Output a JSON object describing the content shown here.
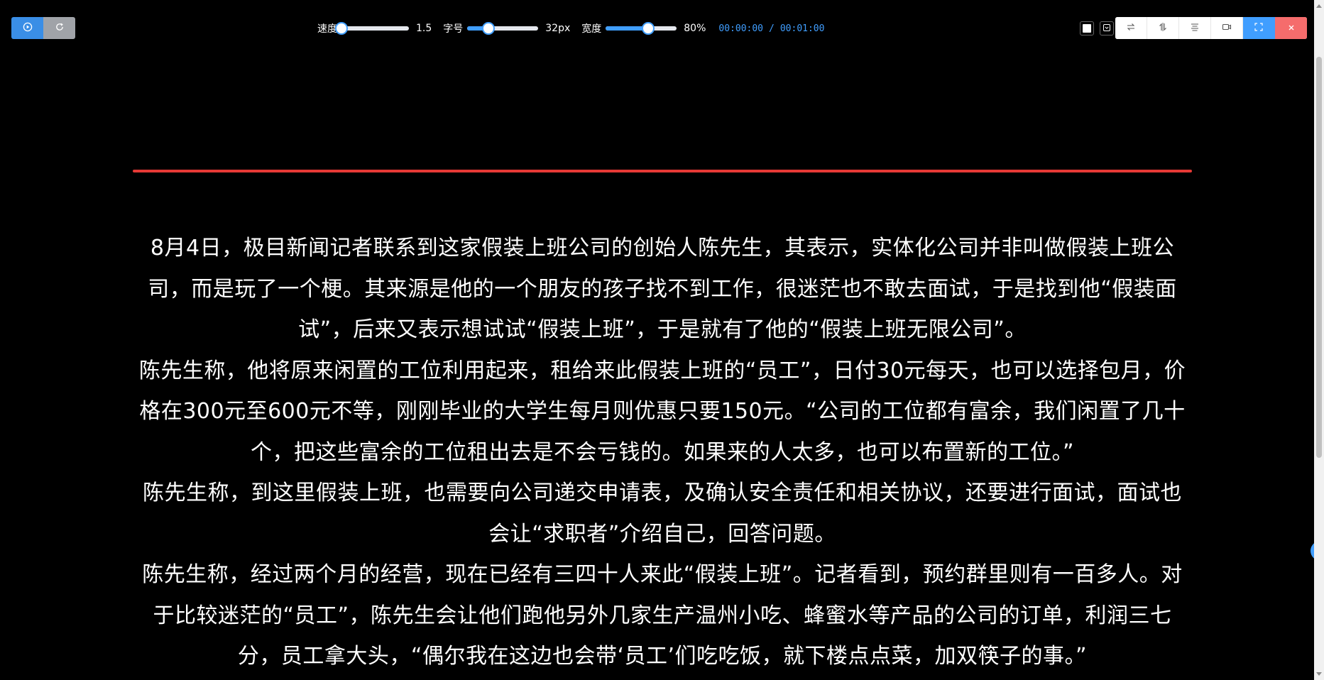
{
  "toolbar": {
    "play_icon": "play-circle-icon",
    "reset_icon": "refresh-icon",
    "speed": {
      "label": "速度",
      "value": 1.5,
      "display": "1.5",
      "fraction": 0.0
    },
    "font_size": {
      "label": "字号",
      "value": 32,
      "display": "32px",
      "fraction": 0.3
    },
    "width": {
      "label": "宽度",
      "value": 80,
      "display": "80%",
      "fraction": 0.6
    },
    "time": {
      "elapsed": "00:00:00",
      "separator": "/",
      "total": "00:01:00"
    }
  },
  "right_controls": {
    "text_color": "#ffffff",
    "toggle_icon": "checkbox-chevron-icon",
    "buttons": [
      {
        "name": "flip-horizontal",
        "icon": "flip-horizontal-icon"
      },
      {
        "name": "flip-vertical",
        "icon": "flip-vertical-icon"
      },
      {
        "name": "align-center",
        "icon": "align-center-icon"
      },
      {
        "name": "camera",
        "icon": "video-camera-icon"
      },
      {
        "name": "fullscreen",
        "icon": "fullscreen-icon"
      },
      {
        "name": "close",
        "icon": "close-icon"
      }
    ]
  },
  "colors": {
    "background": "#000000",
    "text": "#ffffff",
    "accent": "#409eff",
    "guide_line": "#e53935",
    "close": "#f56c6c"
  },
  "content": {
    "paragraphs": [
      "8月4日，极目新闻记者联系到这家假装上班公司的创始人陈先生，其表示，实体化公司并非叫做假装上班公司，而是玩了一个梗。其来源是他的一个朋友的孩子找不到工作，很迷茫也不敢去面试，于是找到他“假装面试”，后来又表示想试试“假装上班”，于是就有了他的“假装上班无限公司”。",
      "陈先生称，他将原来闲置的工位利用起来，租给来此假装上班的“员工”，日付30元每天，也可以选择包月，价格在300元至600元不等，刚刚毕业的大学生每月则优惠只要150元。“公司的工位都有富余，我们闲置了几十个，把这些富余的工位租出去是不会亏钱的。如果来的人太多，也可以布置新的工位。”",
      "陈先生称，到这里假装上班，也需要向公司递交申请表，及确认安全责任和相关协议，还要进行面试，面试也会让“求职者”介绍自己，回答问题。",
      "陈先生称，经过两个月的经营，现在已经有三四十人来此“假装上班”。记者看到，预约群里则有一百多人。对于比较迷茫的“员工”，陈先生会让他们跑他另外几家生产温州小吃、蜂蜜水等产品的公司的订单，利润三七分，员工拿大头，“偶尔我在这边也会带‘员工’们吃吃饭，就下楼点点菜，加双筷子的事。”"
    ]
  }
}
